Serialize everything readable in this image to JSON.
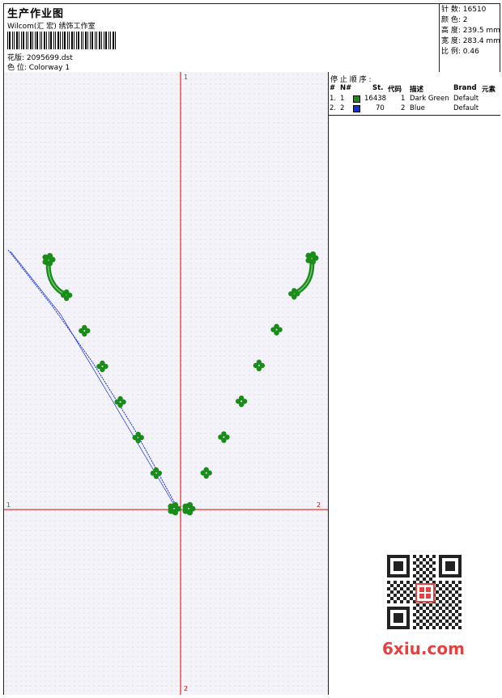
{
  "header": {
    "title": "生产作业图",
    "company": "Wilcom(汇 宏) 绣饰工作室",
    "design_line": "花版:  2095699.dst",
    "colorway_line": "色 位:  Colorway 1"
  },
  "stats": [
    {
      "label": "针 数:",
      "value": "16510"
    },
    {
      "label": "颜 色:",
      "value": "2"
    },
    {
      "label": "高 度:",
      "value": "239.5 mm"
    },
    {
      "label": "宽 度:",
      "value": "283.4 mm"
    },
    {
      "label": "比 例:",
      "value": "0.46"
    }
  ],
  "stop_sequence": {
    "title": "停 止 顺 序 :",
    "columns": {
      "num": "#",
      "n": "N#",
      "st": "St.",
      "code": "代码",
      "desc": "描述",
      "brand": "Brand",
      "element": "元素"
    },
    "rows": [
      {
        "num": "1.",
        "n": "1",
        "color": "#1a8c1a",
        "st": "16438",
        "code": "1",
        "desc": "Dark Green",
        "brand": "Default"
      },
      {
        "num": "2.",
        "n": "2",
        "color": "#1030e0",
        "st": "70",
        "code": "2",
        "desc": "Blue",
        "brand": "Default"
      }
    ]
  },
  "axis_labels": {
    "top": "1",
    "bottom": "2",
    "left": "1",
    "right": "2"
  },
  "watermark": {
    "text": "6xiu.com"
  },
  "colors": {
    "thread_green": "#1a8c1a",
    "thread_blue": "#1030e0",
    "axis_red": "#e00000"
  }
}
